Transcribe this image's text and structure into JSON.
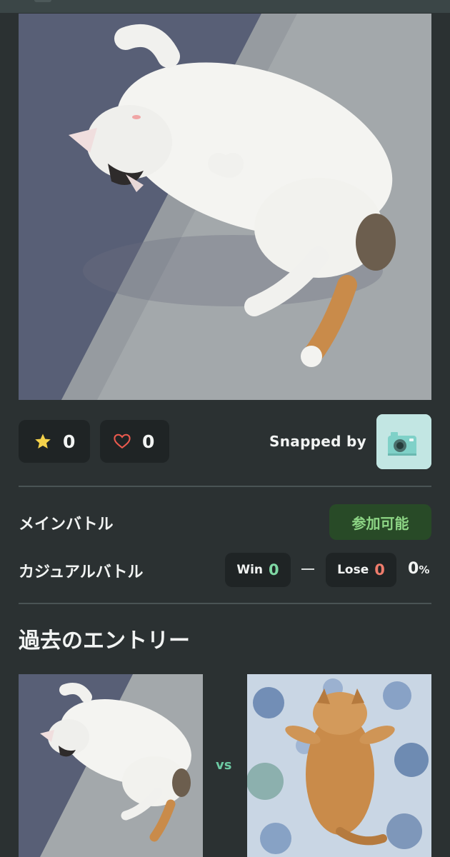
{
  "photo": {
    "subject": "white-calico-cat-sunbathing"
  },
  "stats": {
    "stars": "0",
    "likes": "0"
  },
  "snapped_by": {
    "label": "Snapped by",
    "avatar_icon": "camera-icon"
  },
  "battles": {
    "main": {
      "label": "メインバトル",
      "status": "参加可能"
    },
    "casual": {
      "label": "カジュアルバトル",
      "win_label": "Win",
      "win_count": "0",
      "lose_label": "Lose",
      "lose_count": "0",
      "win_rate": "0",
      "win_rate_unit": "%"
    }
  },
  "past_entries": {
    "title": "過去のエントリー",
    "vs_label": "vs"
  },
  "colors": {
    "background": "#2b3132",
    "card": "#1f2425",
    "star": "#f4d24b",
    "heart": "#ec5a4e",
    "status_green_bg": "#284a27",
    "status_green_text": "#8dd585",
    "win_accent": "#7fd8a4",
    "lose_accent": "#ee7c6c",
    "vs_accent": "#6cc9a3"
  }
}
